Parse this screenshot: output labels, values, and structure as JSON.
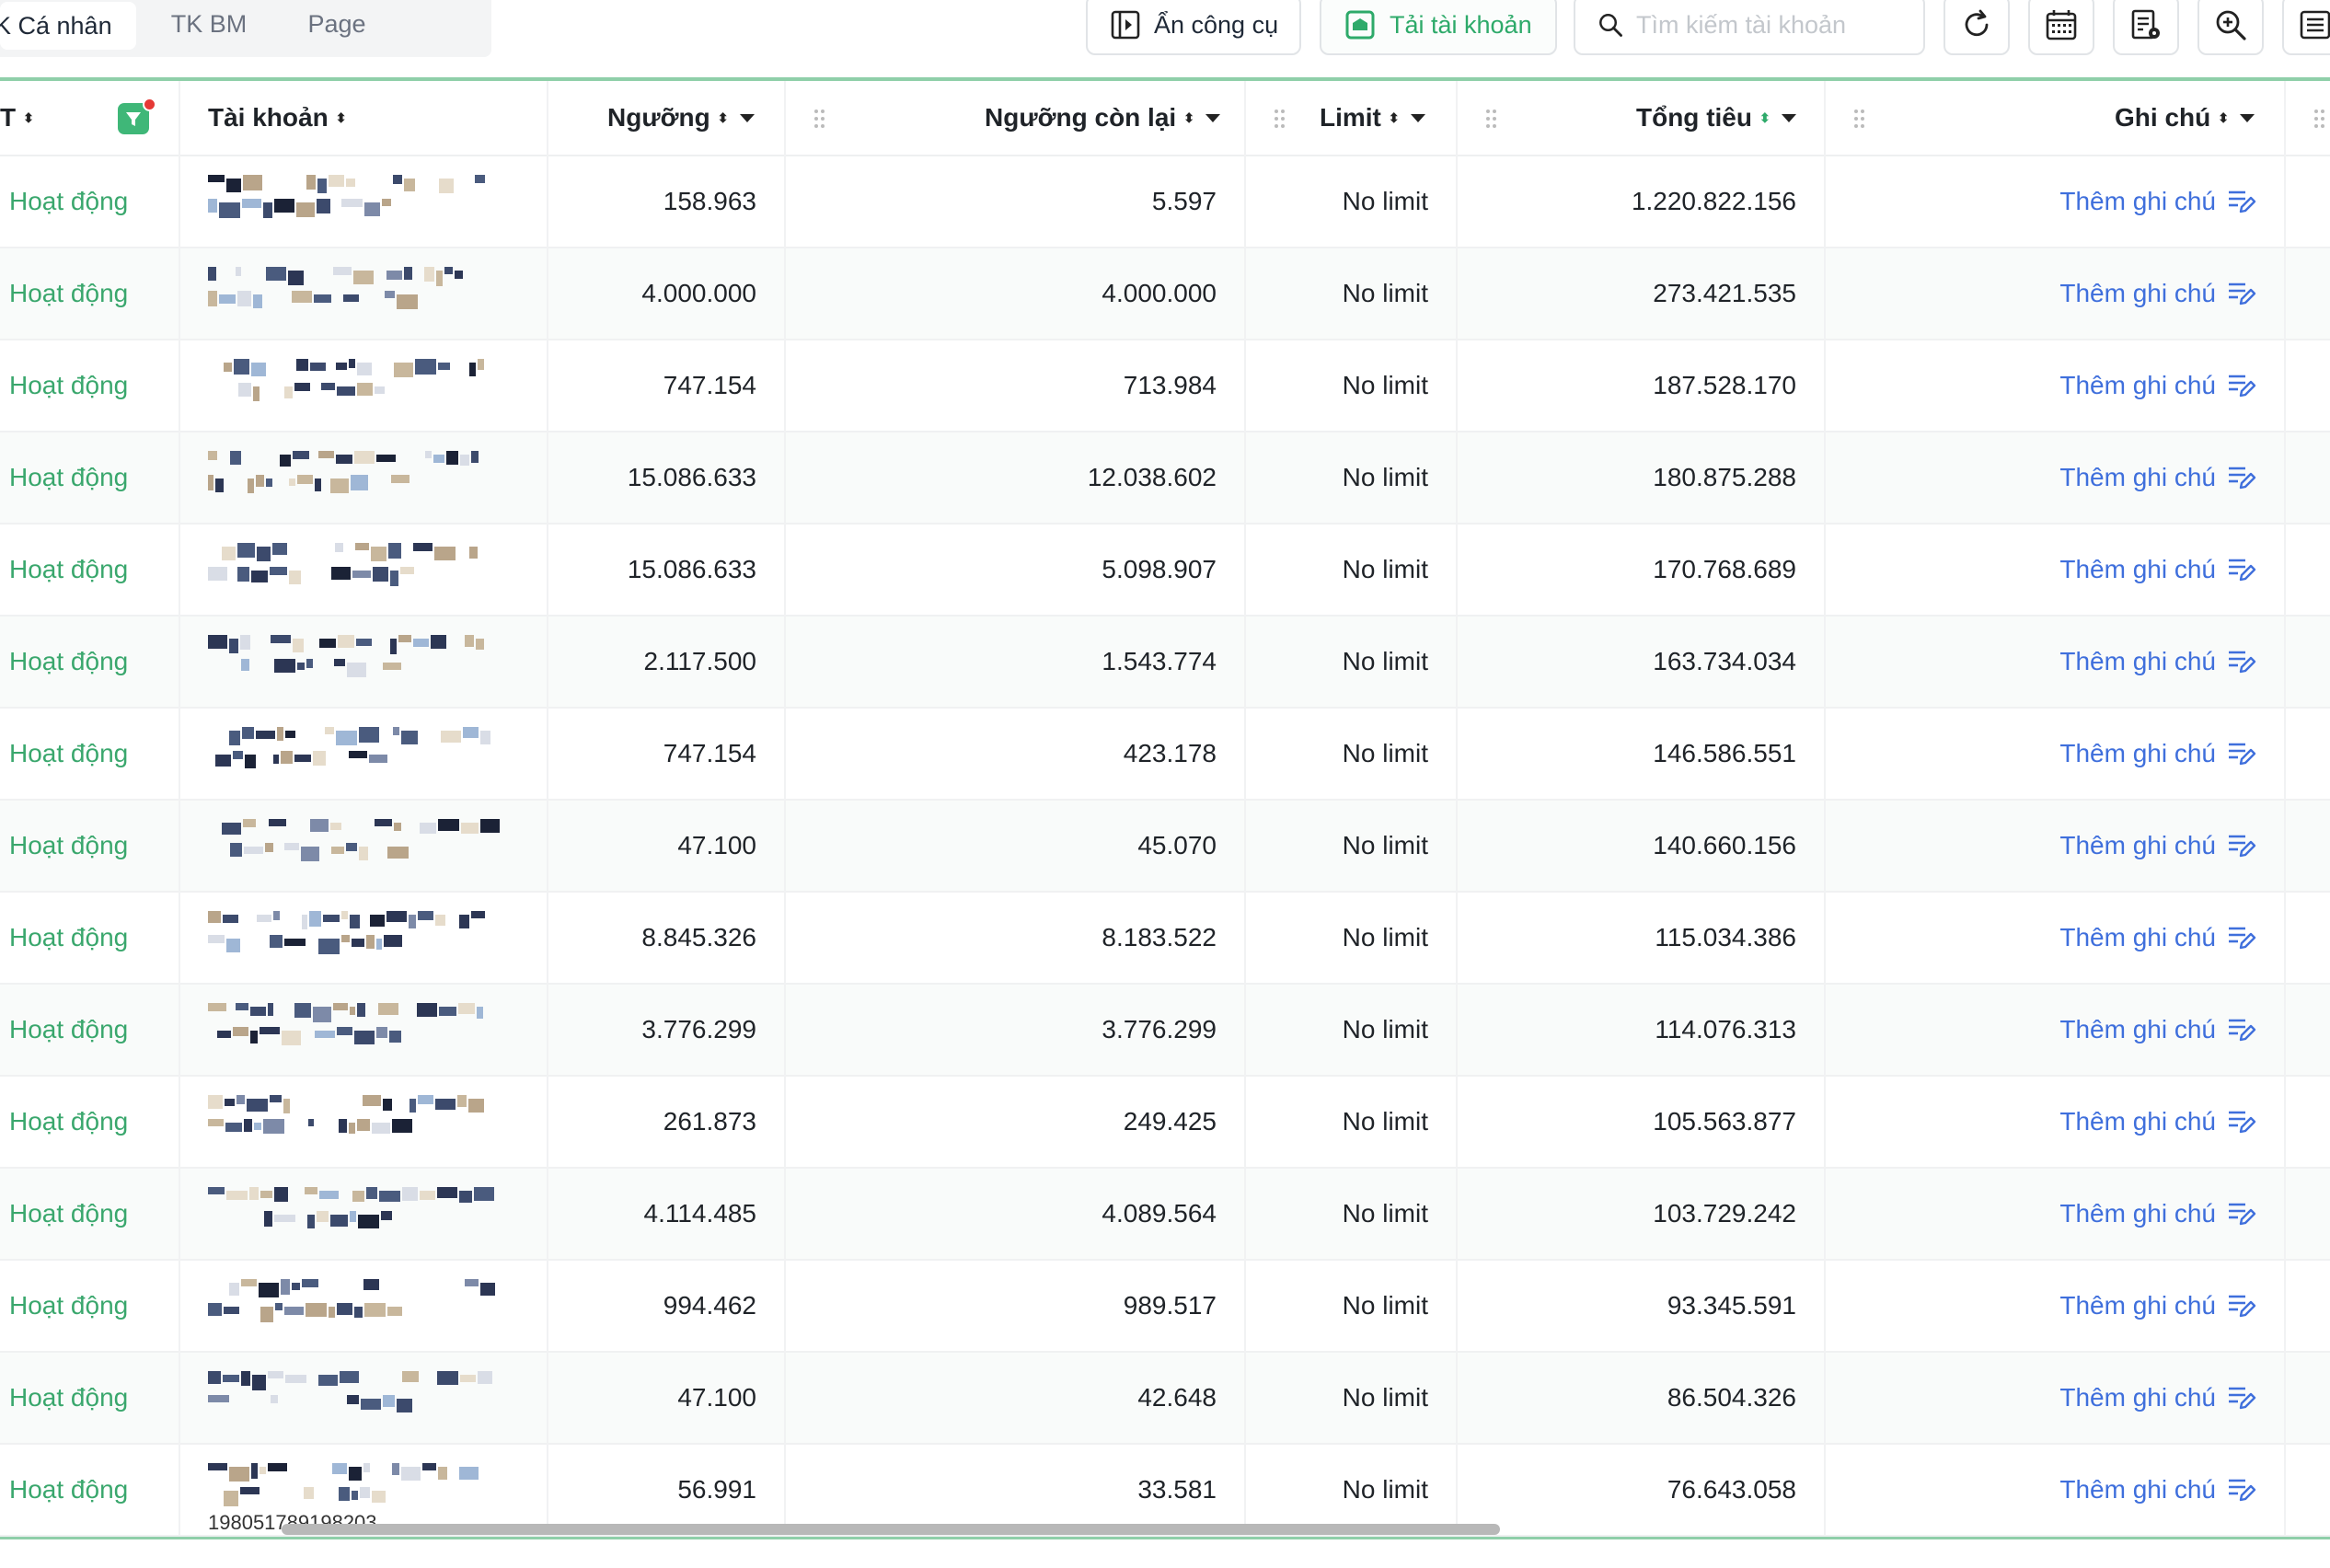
{
  "tabs": [
    {
      "label": "K Cá nhân",
      "active": true
    },
    {
      "label": "TK BM",
      "active": false
    },
    {
      "label": "Page",
      "active": false
    }
  ],
  "toolbar": {
    "hide_tools_label": "Ẩn công cụ",
    "load_accounts_label": "Tải tài khoản",
    "search_placeholder": "Tìm kiếm tài khoản",
    "accent_color": "#2eaa6a"
  },
  "columns": {
    "status_partial": "T",
    "account": "Tài khoản",
    "threshold": "Ngưỡng",
    "threshold_remaining": "Ngưỡng còn lại",
    "limit": "Limit",
    "total_spend": "Tổng tiêu",
    "note": "Ghi chú"
  },
  "rows": [
    {
      "status": "Hoạt động",
      "threshold": "158.963",
      "remaining": "5.597",
      "limit": "No limit",
      "total": "1.220.822.156",
      "note": "Thêm ghi chú"
    },
    {
      "status": "Hoạt động",
      "threshold": "4.000.000",
      "remaining": "4.000.000",
      "limit": "No limit",
      "total": "273.421.535",
      "note": "Thêm ghi chú"
    },
    {
      "status": "Hoạt động",
      "threshold": "747.154",
      "remaining": "713.984",
      "limit": "No limit",
      "total": "187.528.170",
      "note": "Thêm ghi chú"
    },
    {
      "status": "Hoạt động",
      "threshold": "15.086.633",
      "remaining": "12.038.602",
      "limit": "No limit",
      "total": "180.875.288",
      "note": "Thêm ghi chú"
    },
    {
      "status": "Hoạt động",
      "threshold": "15.086.633",
      "remaining": "5.098.907",
      "limit": "No limit",
      "total": "170.768.689",
      "note": "Thêm ghi chú"
    },
    {
      "status": "Hoạt động",
      "threshold": "2.117.500",
      "remaining": "1.543.774",
      "limit": "No limit",
      "total": "163.734.034",
      "note": "Thêm ghi chú"
    },
    {
      "status": "Hoạt động",
      "threshold": "747.154",
      "remaining": "423.178",
      "limit": "No limit",
      "total": "146.586.551",
      "note": "Thêm ghi chú"
    },
    {
      "status": "Hoạt động",
      "threshold": "47.100",
      "remaining": "45.070",
      "limit": "No limit",
      "total": "140.660.156",
      "note": "Thêm ghi chú"
    },
    {
      "status": "Hoạt động",
      "threshold": "8.845.326",
      "remaining": "8.183.522",
      "limit": "No limit",
      "total": "115.034.386",
      "note": "Thêm ghi chú"
    },
    {
      "status": "Hoạt động",
      "threshold": "3.776.299",
      "remaining": "3.776.299",
      "limit": "No limit",
      "total": "114.076.313",
      "note": "Thêm ghi chú"
    },
    {
      "status": "Hoạt động",
      "threshold": "261.873",
      "remaining": "249.425",
      "limit": "No limit",
      "total": "105.563.877",
      "note": "Thêm ghi chú"
    },
    {
      "status": "Hoạt động",
      "threshold": "4.114.485",
      "remaining": "4.089.564",
      "limit": "No limit",
      "total": "103.729.242",
      "note": "Thêm ghi chú"
    },
    {
      "status": "Hoạt động",
      "threshold": "994.462",
      "remaining": "989.517",
      "limit": "No limit",
      "total": "93.345.591",
      "note": "Thêm ghi chú"
    },
    {
      "status": "Hoạt động",
      "threshold": "47.100",
      "remaining": "42.648",
      "limit": "No limit",
      "total": "86.504.326",
      "note": "Thêm ghi chú"
    },
    {
      "status": "Hoạt động",
      "threshold": "56.991",
      "remaining": "33.581",
      "limit": "No limit",
      "total": "76.643.058",
      "note": "Thêm ghi chú",
      "account_id": "198051789198203"
    }
  ],
  "colors": {
    "status": "#3aa76d",
    "note_link": "#3f6fdc",
    "header_border": "#8fcfa9"
  }
}
